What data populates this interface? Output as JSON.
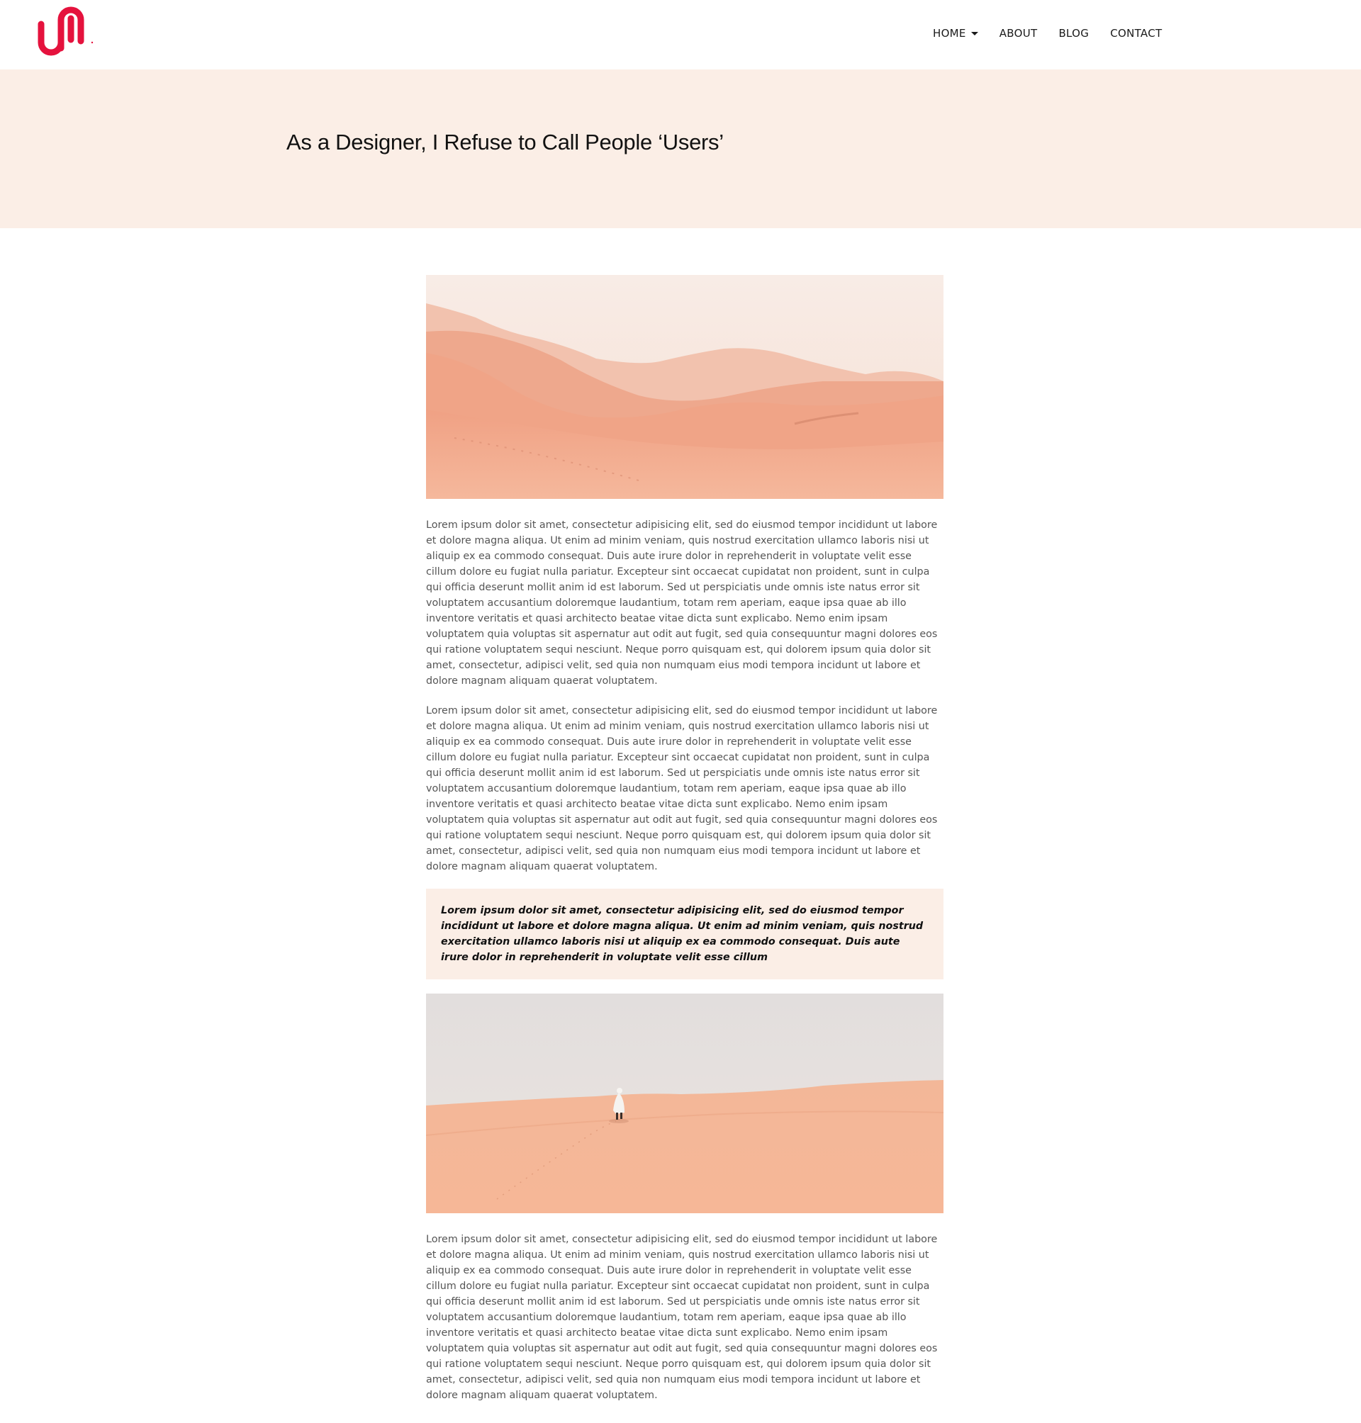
{
  "header": {
    "logo_icon": "brand-logo-icon",
    "brand_color": "#e5123d",
    "nav": [
      {
        "label": "HOME",
        "has_dropdown": true,
        "icon": "caret-down-icon"
      },
      {
        "label": "ABOUT"
      },
      {
        "label": "BLOG"
      },
      {
        "label": "CONTACT"
      }
    ]
  },
  "hero": {
    "title": "As a Designer, I Refuse to Call People ‘Users’",
    "background": "#fbeee6"
  },
  "article": {
    "images": [
      {
        "name": "desert-dunes-photo"
      },
      {
        "name": "desert-walker-photo"
      }
    ],
    "paragraphs": [
      "Lorem ipsum dolor sit amet, consectetur adipisicing elit, sed do eiusmod tempor incididunt ut labore et dolore magna aliqua. Ut enim ad minim veniam, quis nostrud exercitation ullamco laboris nisi ut aliquip ex ea commodo consequat. Duis aute irure dolor in reprehenderit in voluptate velit esse cillum dolore eu fugiat nulla pariatur. Excepteur sint occaecat cupidatat non proident, sunt in culpa qui officia deserunt mollit anim id est laborum. Sed ut perspiciatis unde omnis iste natus error sit voluptatem accusantium doloremque laudantium, totam rem aperiam, eaque ipsa quae ab illo inventore veritatis et quasi architecto beatae vitae dicta sunt explicabo. Nemo enim ipsam voluptatem quia voluptas sit aspernatur aut odit aut fugit, sed quia consequuntur magni dolores eos qui ratione voluptatem sequi nesciunt. Neque porro quisquam est, qui dolorem ipsum quia dolor sit amet, consectetur, adipisci velit, sed quia non numquam eius modi tempora incidunt ut labore et dolore magnam aliquam quaerat voluptatem.",
      "Lorem ipsum dolor sit amet, consectetur adipisicing elit, sed do eiusmod tempor incididunt ut labore et dolore magna aliqua. Ut enim ad minim veniam, quis nostrud exercitation ullamco laboris nisi ut aliquip ex ea commodo consequat. Duis aute irure dolor in reprehenderit in voluptate velit esse cillum dolore eu fugiat nulla pariatur. Excepteur sint occaecat cupidatat non proident, sunt in culpa qui officia deserunt mollit anim id est laborum. Sed ut perspiciatis unde omnis iste natus error sit voluptatem accusantium doloremque laudantium, totam rem aperiam, eaque ipsa quae ab illo inventore veritatis et quasi architecto beatae vitae dicta sunt explicabo. Nemo enim ipsam voluptatem quia voluptas sit aspernatur aut odit aut fugit, sed quia consequuntur magni dolores eos qui ratione voluptatem sequi nesciunt. Neque porro quisquam est, qui dolorem ipsum quia dolor sit amet, consectetur, adipisci velit, sed quia non numquam eius modi tempora incidunt ut labore et dolore magnam aliquam quaerat voluptatem.",
      "Lorem ipsum dolor sit amet, consectetur adipisicing elit, sed do eiusmod tempor incididunt ut labore et dolore magna aliqua. Ut enim ad minim veniam, quis nostrud exercitation ullamco laboris nisi ut aliquip ex ea commodo consequat. Duis aute irure dolor in reprehenderit in voluptate velit esse cillum dolore eu fugiat nulla pariatur. Excepteur sint occaecat cupidatat non proident, sunt in culpa qui officia deserunt mollit anim id est laborum. Sed ut perspiciatis unde omnis iste natus error sit voluptatem accusantium doloremque laudantium, totam rem aperiam, eaque ipsa quae ab illo inventore veritatis et quasi architecto beatae vitae dicta sunt explicabo. Nemo enim ipsam voluptatem quia voluptas sit aspernatur aut odit aut fugit, sed quia consequuntur magni dolores eos qui ratione voluptatem sequi nesciunt. Neque porro quisquam est, qui dolorem ipsum quia dolor sit amet, consectetur, adipisci velit, sed quia non numquam eius modi tempora incidunt ut labore et dolore magnam aliquam quaerat voluptatem."
    ],
    "blockquote": "Lorem ipsum dolor sit amet, consectetur adipisicing elit, sed do eiusmod tempor incididunt ut labore et dolore magna aliqua. Ut enim ad minim veniam, quis nostrud exercitation ullamco laboris nisi ut aliquip ex ea commodo consequat. Duis aute irure dolor in reprehenderit in voluptate velit esse cillum"
  }
}
